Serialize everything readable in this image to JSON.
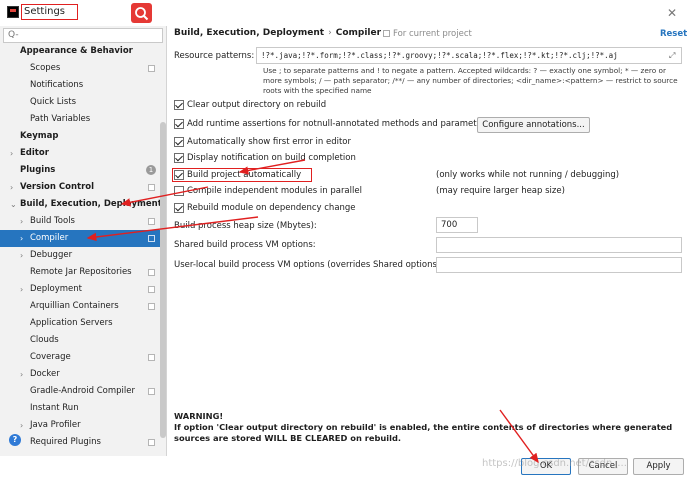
{
  "window": {
    "title": "Settings",
    "close_glyph": "✕"
  },
  "sidebar": {
    "search_placeholder": "Q-",
    "items": [
      {
        "label": "Appearance & Behavior",
        "type": "top",
        "arrow": ""
      },
      {
        "label": "Scopes",
        "type": "child",
        "proj": true
      },
      {
        "label": "Notifications",
        "type": "child"
      },
      {
        "label": "Quick Lists",
        "type": "child"
      },
      {
        "label": "Path Variables",
        "type": "child"
      },
      {
        "label": "Keymap",
        "type": "top",
        "arrow": ""
      },
      {
        "label": "Editor",
        "type": "top",
        "arrow": "›"
      },
      {
        "label": "Plugins",
        "type": "top",
        "arrow": "",
        "badge": "1"
      },
      {
        "label": "Version Control",
        "type": "top",
        "arrow": "›",
        "proj": true
      },
      {
        "label": "Build, Execution, Deployment",
        "type": "top",
        "arrow": "⌄"
      },
      {
        "label": "Build Tools",
        "type": "child",
        "arrow": "›",
        "proj": true
      },
      {
        "label": "Compiler",
        "type": "child",
        "arrow": "›",
        "proj": true,
        "selected": true
      },
      {
        "label": "Debugger",
        "type": "child",
        "arrow": "›"
      },
      {
        "label": "Remote Jar Repositories",
        "type": "child",
        "proj": true
      },
      {
        "label": "Deployment",
        "type": "child",
        "arrow": "›",
        "proj": true
      },
      {
        "label": "Arquillian Containers",
        "type": "child",
        "proj": true
      },
      {
        "label": "Application Servers",
        "type": "child"
      },
      {
        "label": "Clouds",
        "type": "child"
      },
      {
        "label": "Coverage",
        "type": "child",
        "proj": true
      },
      {
        "label": "Docker",
        "type": "child",
        "arrow": "›"
      },
      {
        "label": "Gradle-Android Compiler",
        "type": "child",
        "proj": true
      },
      {
        "label": "Instant Run",
        "type": "child"
      },
      {
        "label": "Java Profiler",
        "type": "child",
        "arrow": "›"
      },
      {
        "label": "Required Plugins",
        "type": "child",
        "proj": true
      }
    ],
    "help": "?"
  },
  "header": {
    "breadcrumb_1": "Build, Execution, Deployment",
    "breadcrumb_sep": "›",
    "breadcrumb_2": "Compiler",
    "for_project": "For current project",
    "reset": "Reset"
  },
  "resource": {
    "label": "Resource patterns:",
    "value": "!?*.java;!?*.form;!?*.class;!?*.groovy;!?*.scala;!?*.flex;!?*.kt;!?*.clj;!?*.aj",
    "hint": "Use ; to separate patterns and ! to negate a pattern. Accepted wildcards: ? — exactly one symbol; * — zero or more symbols; / — path separator; /**/ — any number of directories; <dir_name>:<pattern> — restrict to source roots with the specified name"
  },
  "options": {
    "clear_output": {
      "label": "Clear output directory on rebuild",
      "checked": true
    },
    "add_assertions": {
      "label": "Add runtime assertions for notnull-annotated methods and parameters",
      "checked": true
    },
    "configure_btn": "Configure annotations...",
    "show_first_error": {
      "label": "Automatically show first error in editor",
      "checked": true
    },
    "display_notification": {
      "label": "Display notification on build completion",
      "checked": true
    },
    "build_auto": {
      "label": "Build project automatically",
      "checked": true,
      "note": "(only works while not running / debugging)"
    },
    "compile_parallel": {
      "label": "Compile independent modules in parallel",
      "checked": false,
      "note": "(may require larger heap size)"
    },
    "rebuild_dependency": {
      "label": "Rebuild module on dependency change",
      "checked": true
    }
  },
  "fields": {
    "heap_label": "Build process heap size (Mbytes):",
    "heap_value": "700",
    "shared_vm_label": "Shared build process VM options:",
    "shared_vm_value": "",
    "user_vm_label": "User-local build process VM options (overrides Shared options):",
    "user_vm_value": ""
  },
  "warning": {
    "title": "WARNING!",
    "body": "If option 'Clear output directory on rebuild' is enabled, the entire contents of directories where generated sources are stored WILL BE CLEARED on rebuild."
  },
  "buttons": {
    "ok": "OK",
    "cancel": "Cancel",
    "apply": "Apply"
  },
  "watermark": "https://blog.csdn.net/csdn_...",
  "colors": {
    "selection": "#2675bf",
    "annotation_red": "#e02020",
    "search_button": "#e53935"
  }
}
